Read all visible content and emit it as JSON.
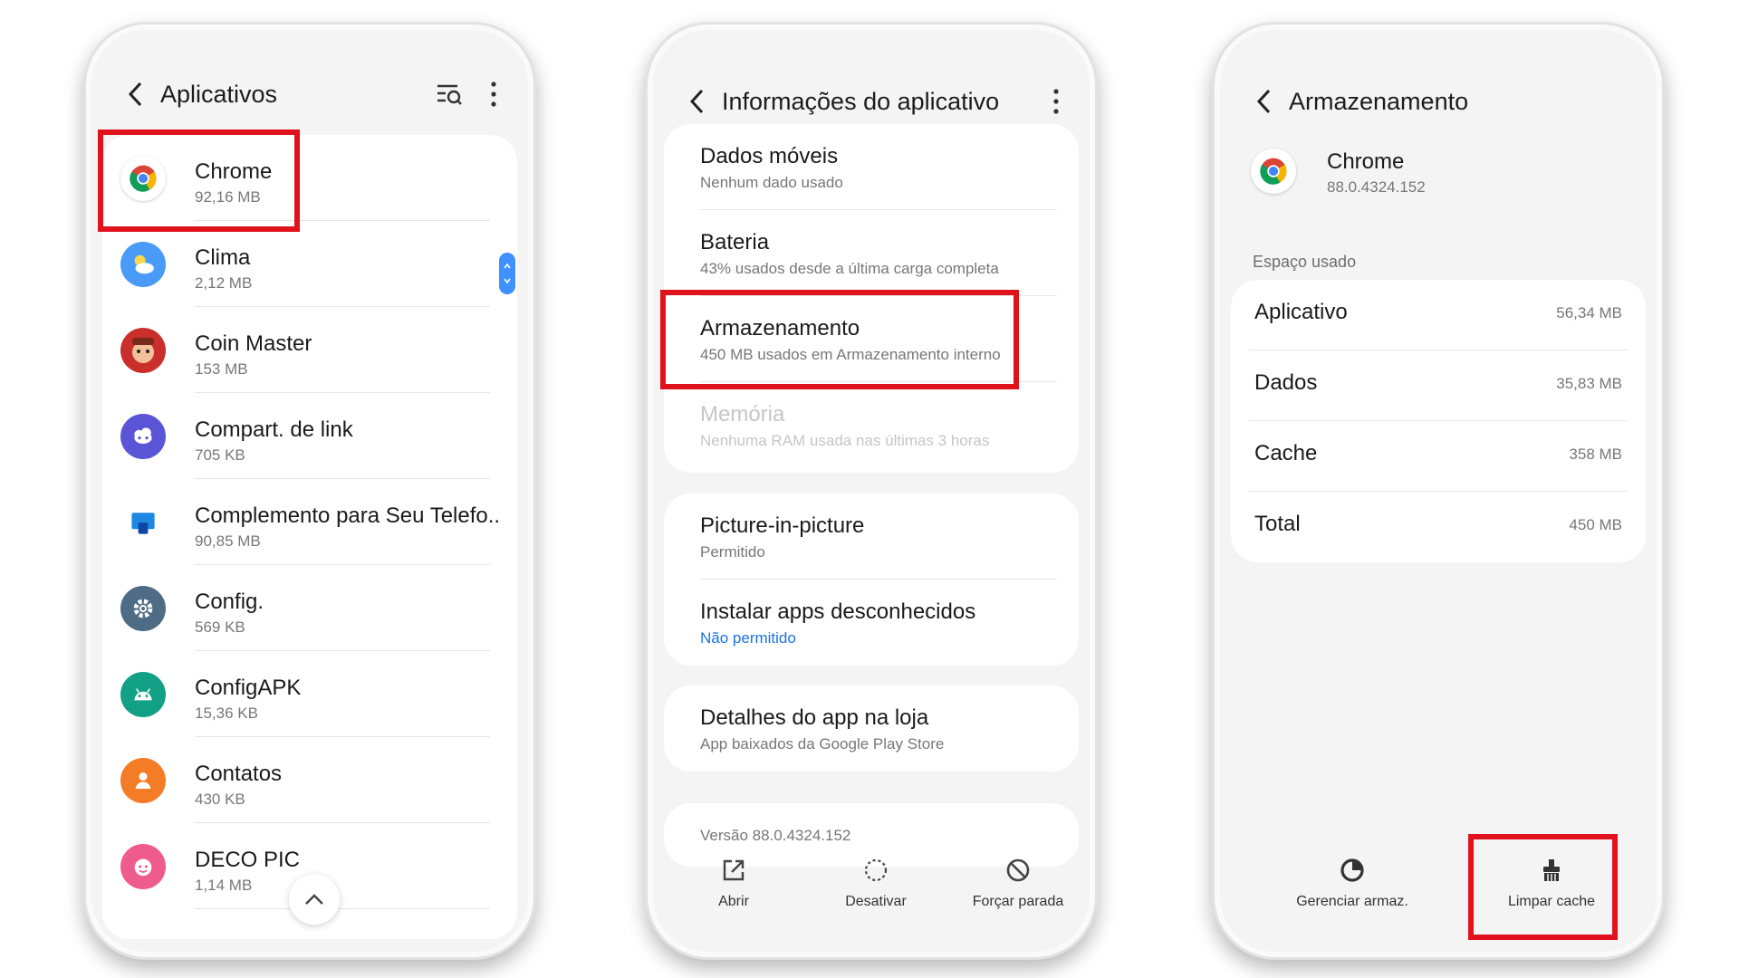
{
  "phone1": {
    "title": "Aplicativos",
    "apps": [
      {
        "name": "Chrome",
        "size": "92,16 MB",
        "icon": "chrome-icon"
      },
      {
        "name": "Clima",
        "size": "2,12 MB",
        "icon": "weather-icon"
      },
      {
        "name": "Coin Master",
        "size": "153 MB",
        "icon": "coin-master-icon"
      },
      {
        "name": "Compart. de link",
        "size": "705 KB",
        "icon": "link-sharing-icon"
      },
      {
        "name": "Complemento para Seu Telefo..",
        "size": "90,85 MB",
        "icon": "your-phone-companion-icon"
      },
      {
        "name": "Config.",
        "size": "569 KB",
        "icon": "settings-gear-icon"
      },
      {
        "name": "ConfigAPK",
        "size": "15,36 KB",
        "icon": "android-icon"
      },
      {
        "name": "Contatos",
        "size": "430 KB",
        "icon": "contacts-icon"
      },
      {
        "name": "DECO PIC",
        "size": "1,14 MB",
        "icon": "deco-pic-icon"
      }
    ]
  },
  "phone2": {
    "title": "Informações do aplicativo",
    "card1": [
      {
        "title": "Dados móveis",
        "sub": "Nenhum dado usado"
      },
      {
        "title": "Bateria",
        "sub": "43% usados desde a última carga completa"
      },
      {
        "title": "Armazenamento",
        "sub": "450 MB usados em Armazenamento interno"
      },
      {
        "title": "Memória",
        "sub": "Nenhuma RAM usada nas últimas 3 horas"
      }
    ],
    "card2": [
      {
        "title": "Picture-in-picture",
        "sub": "Permitido"
      },
      {
        "title": "Instalar apps desconhecidos",
        "sub": "Não permitido"
      }
    ],
    "card3": {
      "title": "Detalhes do app na loja",
      "sub": "App baixados da Google Play Store"
    },
    "version": "Versão 88.0.4324.152",
    "actions": {
      "open": "Abrir",
      "disable": "Desativar",
      "force_stop": "Forçar parada"
    }
  },
  "phone3": {
    "title": "Armazenamento",
    "app_name": "Chrome",
    "app_version": "88.0.4324.152",
    "section": "Espaço usado",
    "rows": [
      {
        "name": "Aplicativo",
        "value": "56,34 MB"
      },
      {
        "name": "Dados",
        "value": "35,83 MB"
      },
      {
        "name": "Cache",
        "value": "358 MB"
      },
      {
        "name": "Total",
        "value": "450 MB"
      }
    ],
    "actions": {
      "manage": "Gerenciar armaz.",
      "clear_cache": "Limpar cache"
    }
  },
  "colors": {
    "highlight": "#e0121c",
    "link": "#1a73e8",
    "scroll": "#3e91ff"
  }
}
